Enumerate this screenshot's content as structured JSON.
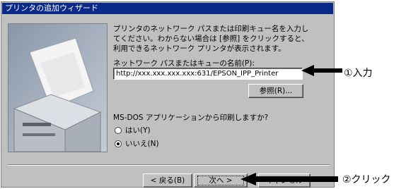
{
  "window": {
    "title": "プリンタの追加ウィザード"
  },
  "wizard": {
    "description": "プリンタのネットワーク パスまたは印刷キュー名を入力してください。わからない場合は [参照] をクリックすると、利用できるネットワーク プリンタが表示されます。",
    "path_label": "ネットワーク パスまたはキューの名前(P):",
    "path_value": "http://xxx.xxx.xxx.xxx:631/EPSON_IPP_Printer",
    "browse_label": "参照(R)...",
    "msdos_question": "MS-DOS アプリケーションから印刷しますか?",
    "options": [
      {
        "label": "はい(Y)",
        "selected": false
      },
      {
        "label": "いいえ(N)",
        "selected": true
      }
    ]
  },
  "buttons": {
    "back": "< 戻る(B)",
    "next": "次へ >",
    "cancel": "キャンセル"
  },
  "callouts": {
    "input": "①入力",
    "click": "②クリック"
  }
}
